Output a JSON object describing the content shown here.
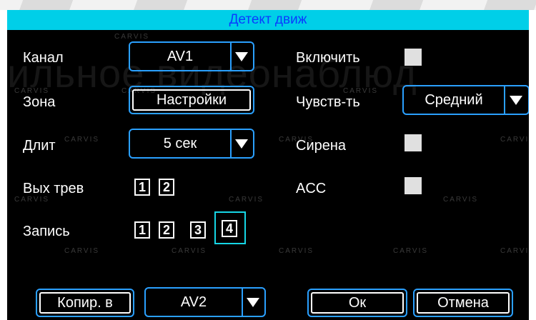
{
  "title": "Детект движ",
  "watermark": {
    "big": "ильное видеонаблюд",
    "brand": "CARVIS"
  },
  "left": {
    "channel": {
      "label": "Канал",
      "value": "AV1"
    },
    "zone": {
      "label": "Зона",
      "button": "Настройки"
    },
    "duration": {
      "label": "Длит",
      "value": "5 сек"
    },
    "alarm_out": {
      "label": "Вых трев",
      "outputs": [
        "1",
        "2"
      ]
    },
    "record": {
      "label": "Запись",
      "channels": [
        "1",
        "2",
        "3",
        "4"
      ]
    }
  },
  "right": {
    "enable": {
      "label": "Включить"
    },
    "sensitivity": {
      "label": "Чувств-ть",
      "value": "Средний"
    },
    "siren": {
      "label": "Сирена"
    },
    "acc": {
      "label": "ACC"
    }
  },
  "footer": {
    "copy_to": "Копир. в",
    "copy_channel": "AV2",
    "ok": "Ок",
    "cancel": "Отмена"
  },
  "colors": {
    "title_bg": "#00cfe8",
    "title_text": "#0a3cff",
    "accent": "#2aa0ff",
    "focus": "#16d6e6"
  }
}
